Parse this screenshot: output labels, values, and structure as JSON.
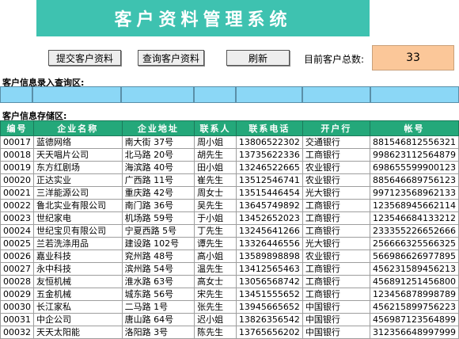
{
  "header": {
    "title": "客户资料管理系统"
  },
  "toolbar": {
    "submit_label": "提交客户资料",
    "query_label": "查询客户资料",
    "refresh_label": "刷新",
    "count_label": "目前客户总数:",
    "count_value": "33"
  },
  "sections": {
    "entry_label": "客户信息录入查询区:",
    "store_label": "客户信息存储区:"
  },
  "table": {
    "columns": [
      "编号",
      "企业名称",
      "企业地址",
      "联系人",
      "联系电话",
      "开户行",
      "帐号"
    ],
    "rows": [
      [
        "00017",
        "蓝德网络",
        "南大街 37号",
        "周小姐",
        "13806522302",
        "交通银行",
        "881546812556321"
      ],
      [
        "00018",
        "天天唱片公司",
        "北马路 20号",
        "胡先生",
        "13735622336",
        "工商银行",
        "998623112564879"
      ],
      [
        "00019",
        "东方红剧场",
        "海滨路 40号",
        "田小姐",
        "13246522665",
        "农业银行",
        "698655599900123"
      ],
      [
        "00020",
        "正达实业",
        "广西路 11号",
        "崔先生",
        "13512546741",
        "农业银行",
        "885646689756123"
      ],
      [
        "00021",
        "三洋能源公司",
        "重庆路 42号",
        "周女士",
        "13515446454",
        "光大银行",
        "997123568962133"
      ],
      [
        "00022",
        "鲁北实业有限公司",
        "南门路 36号",
        "吴先生",
        "13645749892",
        "工商银行",
        "123568945662114"
      ],
      [
        "00023",
        "世纪家电",
        "机场路 59号",
        "于小姐",
        "13452652023",
        "工商银行",
        "123546684133212"
      ],
      [
        "00024",
        "世纪宝贝有限公司",
        "宁夏西路 5号",
        "丁先生",
        "13245641266",
        "工商银行",
        "233355226652666"
      ],
      [
        "00025",
        "兰若洗涤用品",
        "建设路 102号",
        "谭先生",
        "13326446556",
        "光大银行",
        "256666325566325"
      ],
      [
        "00026",
        "嘉业科技",
        "兖州路 48号",
        "高小姐",
        "13589898898",
        "农业银行",
        "566986626977895"
      ],
      [
        "00027",
        "永中科技",
        "滨州路 54号",
        "温先生",
        "13412565463",
        "工商银行",
        "456231589456213"
      ],
      [
        "00028",
        "友恒机械",
        "淮水路 63号",
        "高女士",
        "13056568742",
        "工商银行",
        "456891251456800"
      ],
      [
        "00029",
        "五金机械",
        "城东路 56号",
        "宋先生",
        "13451555652",
        "工商银行",
        "123456878998789"
      ],
      [
        "00030",
        "长江家私",
        "二马路 1号",
        "张先生",
        "13945665652",
        "中国银行",
        "456215899756223"
      ],
      [
        "00031",
        "中企公司",
        "唐山路 64号",
        "迟小姐",
        "13826356542",
        "中国银行",
        "456987123564899"
      ],
      [
        "00032",
        "天天太阳能",
        "洛阳路 3号",
        "陈先生",
        "13765656202",
        "中国银行",
        "312356648997999"
      ]
    ]
  },
  "colors": {
    "title_bg": "#3ec2b0",
    "header_bg": "#24a87a",
    "entry_bg": "#8bd7f6",
    "count_bg": "#fbc799"
  }
}
